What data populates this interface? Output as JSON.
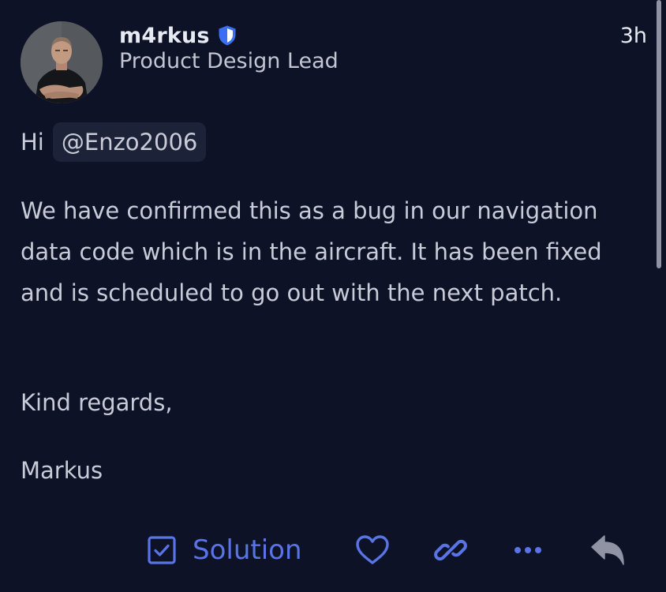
{
  "post": {
    "author": {
      "username": "m4rkus",
      "title": "Product Design Lead",
      "verified_icon": "shield-icon",
      "avatar_icon": "avatar"
    },
    "timestamp": "3h",
    "greeting": "Hi",
    "mention": "@Enzo2006",
    "body": "We have confirmed this as a bug in our navigation data code which is in the aircraft. It has been fixed and is scheduled to go out with the next patch.",
    "closing": "Kind regards,",
    "signature": "Markus"
  },
  "actions": {
    "solution_label": "Solution",
    "icons": [
      "checkbox-icon",
      "heart-icon",
      "link-icon",
      "more-icon",
      "reply-icon"
    ]
  },
  "colors": {
    "background": "#0d1226",
    "accent": "#5a74e6",
    "text": "#c9ccd8",
    "mention_bg": "#1c2238",
    "verified": "#3b6ef0"
  }
}
